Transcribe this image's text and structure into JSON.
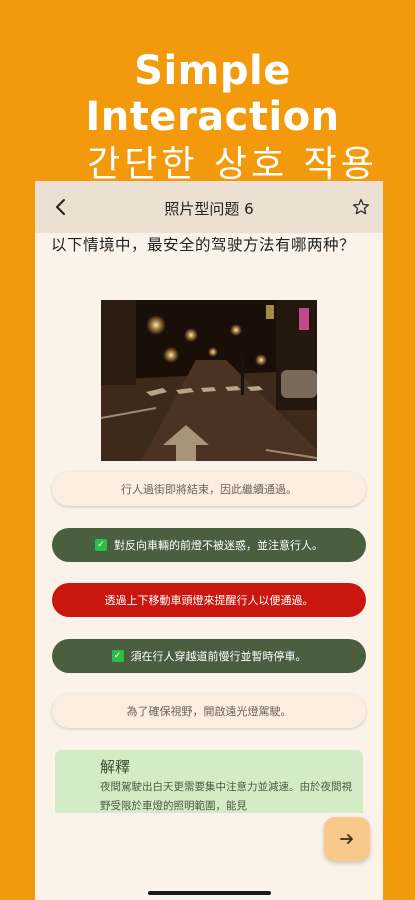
{
  "hero": {
    "title_en": "Simple Interaction",
    "title_ko": "간단한 상호 작용"
  },
  "topbar": {
    "title": "照片型问题 6",
    "back_icon": "chevron-left-icon",
    "favorite_icon": "star-outline-icon"
  },
  "question": {
    "text": "以下情境中，最安全的驾驶方法有哪两种？"
  },
  "photo": {
    "subject": "night street crossing with crosswalk and arrow marking"
  },
  "options": [
    {
      "text": "行人過街即將結束，因此繼續通過。",
      "state": "neutral",
      "checked": false
    },
    {
      "text": "對反向車輛的前燈不被迷惑，並注意行人。",
      "state": "correct",
      "checked": true
    },
    {
      "text": "透過上下移動車頭燈來提醒行人以便通過。",
      "state": "wrong",
      "checked": false
    },
    {
      "text": "須在行人穿越道前慢行並暫時停車。",
      "state": "correct",
      "checked": true
    },
    {
      "text": "為了確保視野，開啟遠光燈駕駛。",
      "state": "neutral",
      "checked": false
    }
  ],
  "explanation": {
    "heading": "解釋",
    "body": "夜間駕駛出白天更需要集中注意力並減速。由於夜間視野受限於車燈的照明範圍，能見"
  },
  "next_button": {
    "icon": "arrow-right-icon"
  },
  "colors": {
    "background": "#f39a0c",
    "correct": "#4a5e40",
    "wrong": "#c9160e",
    "neutral": "#fbeee0",
    "explanation_bg": "#d3ecc6",
    "topbar": "#ece0d2"
  }
}
